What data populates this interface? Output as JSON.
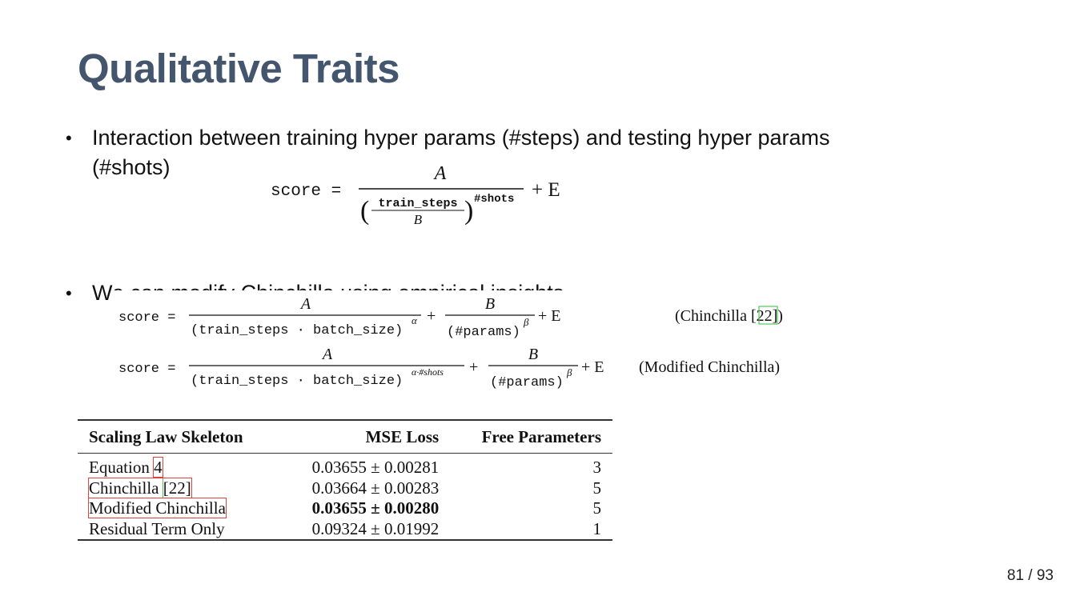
{
  "slide": {
    "title": "Qualitative Traits",
    "bullets": [
      {
        "line1": "Interaction between training hyper params (#steps) and testing hyper params",
        "line2": "(#shots)"
      },
      {
        "text": "We can modify Chinchilla using empirical insights"
      }
    ],
    "bullet_symbol": "•"
  },
  "formula_main": {
    "lhs": "score =",
    "numerator": "A",
    "frac_top": "train_steps",
    "frac_bottom": "B",
    "exponent": "#shots",
    "tail": "+ E"
  },
  "formulas": {
    "lhs": "score =",
    "row1": {
      "num_a": "A",
      "den_a": "(train_steps · batch_size)",
      "exp_a": "α",
      "plus": "+",
      "num_b": "B",
      "den_b": "(#params)",
      "exp_b": "β",
      "tail": "+ E",
      "label_pre": "(Chinchilla [",
      "label_ref": "22",
      "label_post": "])"
    },
    "row2": {
      "num_a": "A",
      "den_a": "(train_steps · batch_size)",
      "exp_a": "α·#shots",
      "plus": "+",
      "num_b": "B",
      "den_b": "(#params)",
      "exp_b": "β",
      "tail": "+ E",
      "label": "(Modified Chinchilla)"
    }
  },
  "table": {
    "headers": [
      "Scaling Law Skeleton",
      "MSE Loss",
      "Free Parameters"
    ],
    "rows": [
      {
        "name_pre": "Equation ",
        "name_ref": "4",
        "name_post": "",
        "mse": "0.03655 ± 0.00281",
        "params": "3"
      },
      {
        "name_pre": "Chinchilla ",
        "name_ref": "[22]",
        "name_post": "",
        "mse": "0.03664 ± 0.00283",
        "params": "5"
      },
      {
        "name": "Modified Chinchilla",
        "mse": "0.03655 ± 0.00280",
        "params": "5"
      },
      {
        "name": "Residual Term Only",
        "mse": "0.09324 ± 0.01992",
        "params": "1"
      }
    ]
  },
  "footer": {
    "page": "81 / 93"
  },
  "colors": {
    "title": "#44556e",
    "highlight_box": "#e0413a",
    "ref_box": "#58c558"
  }
}
